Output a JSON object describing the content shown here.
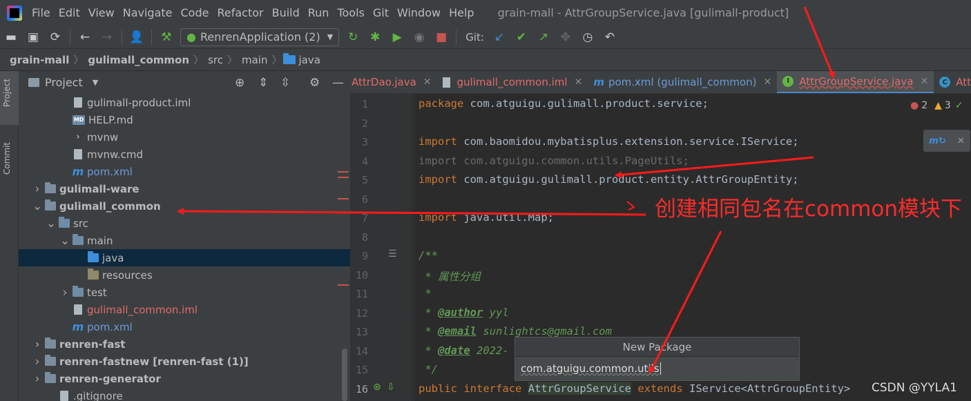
{
  "menubar": {
    "items": [
      "File",
      "Edit",
      "View",
      "Navigate",
      "Code",
      "Refactor",
      "Build",
      "Run",
      "Tools",
      "Git",
      "Window",
      "Help"
    ],
    "window_title": "grain-mall - AttrGroupService.java [gulimall-product]"
  },
  "toolbar": {
    "run_config": "RenrenApplication (2)",
    "git_label": "Git:"
  },
  "breadcrumb": [
    "grain-mall",
    "gulimall_common",
    "src",
    "main",
    "java"
  ],
  "project_panel": {
    "title": "Project",
    "tree": [
      {
        "label": "gulimall-product.iml",
        "icon": "iml-file-icon",
        "style": "normal"
      },
      {
        "label": "HELP.md",
        "icon": "markdown-icon",
        "style": "normal"
      },
      {
        "label": "mvnw",
        "icon": "terminal-icon",
        "style": "normal"
      },
      {
        "label": "mvnw.cmd",
        "icon": "file-icon",
        "style": "normal"
      },
      {
        "label": "pom.xml",
        "icon": "maven-icon",
        "style": "blue"
      },
      {
        "label": "gulimall-ware",
        "icon": "module-folder-icon",
        "style": "bold"
      },
      {
        "label": "gulimall_common",
        "icon": "module-folder-icon",
        "style": "bold"
      },
      {
        "label": "src",
        "icon": "folder-icon",
        "style": "normal"
      },
      {
        "label": "main",
        "icon": "folder-icon",
        "style": "normal"
      },
      {
        "label": "java",
        "icon": "source-folder-icon",
        "style": "normal"
      },
      {
        "label": "resources",
        "icon": "resources-folder-icon",
        "style": "normal"
      },
      {
        "label": "test",
        "icon": "folder-icon",
        "style": "normal"
      },
      {
        "label": "gulimall_common.iml",
        "icon": "iml-file-icon",
        "style": "red"
      },
      {
        "label": "pom.xml",
        "icon": "maven-icon",
        "style": "blue"
      },
      {
        "label": "renren-fast",
        "icon": "module-folder-icon",
        "style": "bold"
      },
      {
        "label": "renren-fastnew",
        "suffix": "[renren-fast (1)]",
        "icon": "module-folder-icon",
        "style": "normal"
      },
      {
        "label": "renren-generator",
        "icon": "module-folder-icon",
        "style": "bold"
      },
      {
        "label": ".gitignore",
        "icon": "file-icon",
        "style": "normal"
      }
    ]
  },
  "sidestrip": {
    "project": "Project",
    "commit": "Commit"
  },
  "editor_tabs": [
    {
      "label": "AttrDao.java",
      "active": false
    },
    {
      "label": "gulimall_common.iml",
      "active": false
    },
    {
      "label": "pom.xml (gulimall_common)",
      "active": false
    },
    {
      "label": "AttrGroupService.java",
      "active": true
    },
    {
      "label": "AttrG",
      "active": false
    }
  ],
  "inspections": {
    "errors": "2",
    "warnings": "3"
  },
  "code_lines": [
    [
      "1",
      "package com.atguigu.gulimall.product.service;"
    ],
    [
      "2",
      ""
    ],
    [
      "3",
      "import com.baomidou.mybatisplus.extension.service.IService;"
    ],
    [
      "4",
      "import com.atguigu.common.utils.PageUtils;"
    ],
    [
      "5",
      "import com.atguigu.gulimall.product.entity.AttrGroupEntity;"
    ],
    [
      "6",
      ""
    ],
    [
      "7",
      "import java.util.Map;"
    ],
    [
      "8",
      ""
    ],
    [
      "9",
      "/**"
    ],
    [
      "10",
      " * 属性分组"
    ],
    [
      "11",
      " *"
    ],
    [
      "12",
      " * @author yyl"
    ],
    [
      "13",
      " * @email sunlightcs@gmail.com"
    ],
    [
      "14",
      " * @date 2022-"
    ],
    [
      "15",
      " */"
    ],
    [
      "16",
      "public interface AttrGroupService extends IService<AttrGroupEntity>"
    ]
  ],
  "popup": {
    "title": "New Package",
    "value": "com.atguigu.common.utils"
  },
  "annotation": "创建相同包名在common模块下",
  "watermark": "CSDN @YYLA1",
  "colors": {
    "annotation_red": "#ff2a2a",
    "selection": "#0d293e",
    "active_tab_underline": "#4a88c7"
  }
}
